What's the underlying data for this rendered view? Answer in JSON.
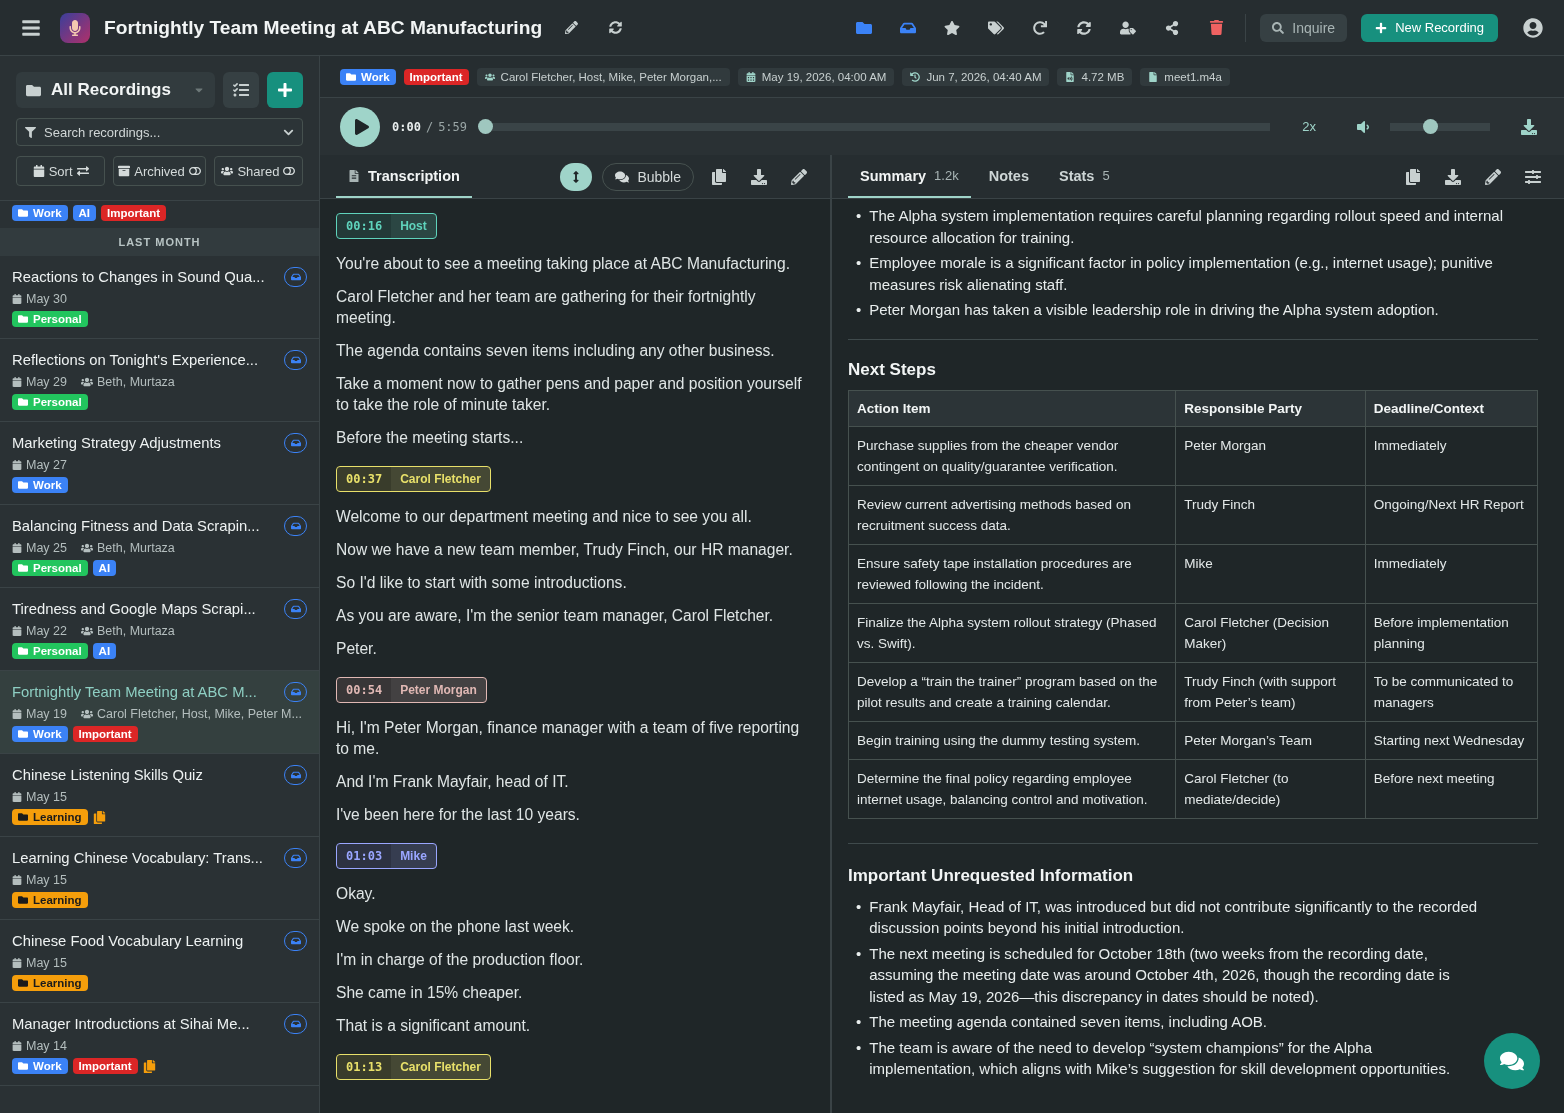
{
  "header": {
    "title": "Fortnightly Team Meeting at ABC Manufacturing",
    "inquire": "Inquire",
    "new_recording": "New Recording"
  },
  "sidebar": {
    "folder": "All Recordings",
    "search_placeholder": "Search recordings...",
    "filters": [
      {
        "kind": "sort",
        "label": "Sort"
      },
      {
        "kind": "archived",
        "label": "Archived"
      },
      {
        "kind": "shared",
        "label": "Shared"
      }
    ],
    "clipped_tags": [
      {
        "label": "Work",
        "color": "#3b82f6",
        "kind": "folder"
      },
      {
        "label": "AI",
        "color": "#3b82f6",
        "kind": "label"
      },
      {
        "label": "Important",
        "color": "#dc2626",
        "kind": "label"
      }
    ],
    "section": "LAST MONTH",
    "items": [
      {
        "title": "Reactions to Changes in Sound Qua...",
        "date": "May 30",
        "selected": false,
        "copies": false,
        "tags": [
          {
            "label": "Personal",
            "color": "#22c55e",
            "kind": "folder"
          }
        ]
      },
      {
        "title": "Reflections on Tonight's Experience...",
        "date": "May 29",
        "people": "Beth, Murtaza",
        "selected": false,
        "copies": false,
        "tags": [
          {
            "label": "Personal",
            "color": "#22c55e",
            "kind": "folder"
          }
        ]
      },
      {
        "title": "Marketing Strategy Adjustments",
        "date": "May 27",
        "selected": false,
        "copies": false,
        "tags": [
          {
            "label": "Work",
            "color": "#3b82f6",
            "kind": "folder"
          }
        ]
      },
      {
        "title": "Balancing Fitness and Data Scrapin...",
        "date": "May 25",
        "people": "Beth, Murtaza",
        "selected": false,
        "copies": false,
        "tags": [
          {
            "label": "Personal",
            "color": "#22c55e",
            "kind": "folder"
          },
          {
            "label": "AI",
            "color": "#3b82f6",
            "kind": "label"
          }
        ]
      },
      {
        "title": "Tiredness and Google Maps Scrapi...",
        "date": "May 22",
        "people": "Beth, Murtaza",
        "selected": false,
        "copies": false,
        "tags": [
          {
            "label": "Personal",
            "color": "#22c55e",
            "kind": "folder"
          },
          {
            "label": "AI",
            "color": "#3b82f6",
            "kind": "label"
          }
        ]
      },
      {
        "title": "Fortnightly Team Meeting at ABC M...",
        "date": "May 19",
        "people": "Carol Fletcher, Host, Mike, Peter M...",
        "selected": true,
        "copies": false,
        "tags": [
          {
            "label": "Work",
            "color": "#3b82f6",
            "kind": "folder"
          },
          {
            "label": "Important",
            "color": "#dc2626",
            "kind": "label"
          }
        ]
      },
      {
        "title": "Chinese Listening Skills Quiz",
        "date": "May 15",
        "selected": false,
        "copies": true,
        "tags": [
          {
            "label": "Learning",
            "color": "#f59e0b",
            "kind": "folder"
          }
        ]
      },
      {
        "title": "Learning Chinese Vocabulary: Trans...",
        "date": "May 15",
        "selected": false,
        "copies": false,
        "tags": [
          {
            "label": "Learning",
            "color": "#f59e0b",
            "kind": "folder"
          }
        ]
      },
      {
        "title": "Chinese Food Vocabulary Learning",
        "date": "May 15",
        "selected": false,
        "copies": false,
        "tags": [
          {
            "label": "Learning",
            "color": "#f59e0b",
            "kind": "folder"
          }
        ]
      },
      {
        "title": "Manager Introductions at Sihai Me...",
        "date": "May 14",
        "selected": false,
        "copies": true,
        "tags": [
          {
            "label": "Work",
            "color": "#3b82f6",
            "kind": "folder"
          },
          {
            "label": "Important",
            "color": "#dc2626",
            "kind": "label"
          }
        ]
      }
    ]
  },
  "meta": {
    "tags": [
      {
        "label": "Work",
        "color": "#3b82f6",
        "kind": "folder"
      },
      {
        "label": "Important",
        "color": "#dc2626",
        "kind": "label"
      }
    ],
    "chips": [
      {
        "kind": "people",
        "text": "Carol Fletcher, Host, Mike, Peter Morgan,..."
      },
      {
        "kind": "created",
        "text": "May 19, 2026, 04:00 AM"
      },
      {
        "kind": "updated",
        "text": "Jun 7, 2026, 04:40 AM"
      },
      {
        "kind": "size",
        "text": "4.72 MB"
      },
      {
        "kind": "file",
        "text": "meet1.m4a"
      }
    ]
  },
  "player": {
    "time": "0:00",
    "separator": "/",
    "duration": "5:59",
    "level": 0,
    "speed": "2x",
    "volume": {
      "level": 0.4
    }
  },
  "transcript": {
    "tabs": [
      {
        "label": "Transcription",
        "selected": true
      }
    ],
    "view": "Bubble",
    "segments": [
      {
        "time": "00:16",
        "speaker": "Host",
        "color": "#5fd3bc",
        "lines": [
          "You're about to see a meeting taking place at ABC Manufacturing.",
          "Carol Fletcher and her team are gathering for their fortnightly meeting.",
          "The agenda contains seven items including any other business.",
          "Take a moment now to gather pens and paper and position yourself to take the role of minute taker.",
          "Before the meeting starts..."
        ]
      },
      {
        "time": "00:37",
        "speaker": "Carol Fletcher",
        "color": "#e8e06a",
        "lines": [
          "Welcome to our department meeting and nice to see you all.",
          "Now we have a new team member, Trudy Finch, our HR manager.",
          "So I'd like to start with some introductions.",
          "As you are aware, I'm the senior team manager, Carol Fletcher.",
          "Peter."
        ]
      },
      {
        "time": "00:54",
        "speaker": "Peter Morgan",
        "color": "#e0b8b4",
        "lines": [
          "Hi, I'm Peter Morgan, finance manager with a team of five reporting to me.",
          "And I'm Frank Mayfair, head of IT.",
          "I've been here for the last 10 years."
        ]
      },
      {
        "time": "01:03",
        "speaker": "Mike",
        "color": "#9aa6ff",
        "lines": [
          "Okay.",
          "We spoke on the phone last week.",
          "I'm in charge of the production floor.",
          "She came in 15% cheaper.",
          "That is a significant amount."
        ]
      },
      {
        "time": "01:13",
        "speaker": "Carol Fletcher",
        "color": "#e8e06a"
      }
    ]
  },
  "summary": {
    "tabs": [
      {
        "label": "Summary",
        "count": "1.2k",
        "selected": true
      },
      {
        "label": "Notes",
        "selected": false
      },
      {
        "label": "Stats",
        "count": "5",
        "selected": false
      }
    ],
    "bullet": "•",
    "intro_bullets": [
      "The Alpha system implementation requires careful planning regarding rollout speed and internal resource allocation for training.",
      "Employee morale is a significant factor in policy implementation (e.g., internet usage); punitive measures risk alienating staff.",
      "Peter Morgan has taken a visible leadership role in driving the Alpha system adoption."
    ],
    "next_steps": {
      "heading": "Next Steps",
      "columns": [
        "Action Item",
        "Responsible Party",
        "Deadline/Context"
      ],
      "rows": [
        [
          "Purchase supplies from the cheaper vendor contingent on quality/guarantee verification.",
          "Peter Morgan",
          "Immediately"
        ],
        [
          "Review current advertising methods based on recruitment success data.",
          "Trudy Finch",
          "Ongoing/Next HR Report"
        ],
        [
          "Ensure safety tape installation procedures are reviewed following the incident.",
          "Mike",
          "Immediately"
        ],
        [
          "Finalize the Alpha system rollout strategy (Phased vs. Swift).",
          "Carol Fletcher (Decision Maker)",
          "Before implementation planning"
        ],
        [
          "Develop a “train the trainer” program based on the pilot results and create a training calendar.",
          "Trudy Finch (with support from Peter’s team)",
          "To be communicated to managers"
        ],
        [
          "Begin training using the dummy testing system.",
          "Peter Morgan’s Team",
          "Starting next Wednesday"
        ],
        [
          "Determine the final policy regarding employee internet usage, balancing control and motivation.",
          "Carol Fletcher (to mediate/decide)",
          "Before next meeting"
        ]
      ]
    },
    "unrequested": {
      "heading": "Important Unrequested Information",
      "bullets": [
        "Frank Mayfair, Head of IT, was introduced but did not contribute significantly to the recorded discussion points beyond his initial introduction.",
        "The next meeting is scheduled for October 18th (two weeks from the recording date, assuming the meeting date was around October 4th, 2026, though the recording date is listed as May 19, 2026—this discrepancy in dates should be noted).",
        "The meeting agenda contained seven items, including AOB.",
        "The team is aware of the need to develop “system champions” for the Alpha implementation, which aligns with Mike’s suggestion for skill development opportunities."
      ]
    }
  }
}
